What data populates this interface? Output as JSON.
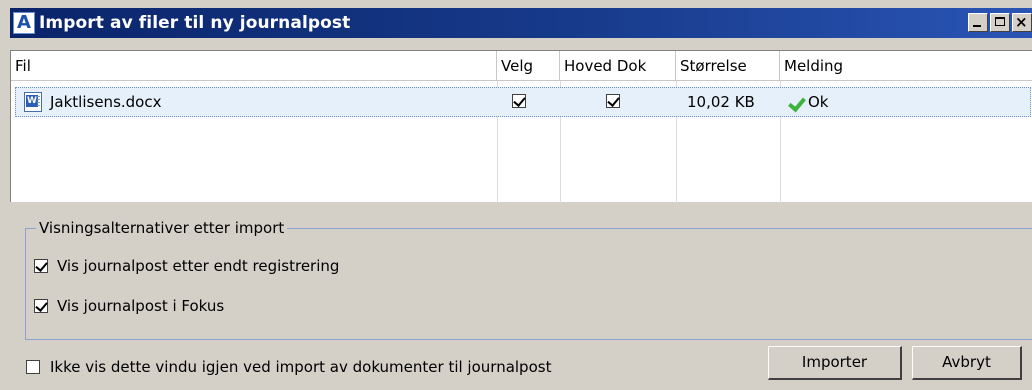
{
  "window": {
    "title": "Import av filer til ny journalpost",
    "app_icon_letter": "A",
    "close_glyph": "×"
  },
  "grid": {
    "columns": [
      "Fil",
      "Velg",
      "Hoved Dok",
      "Størrelse",
      "Melding"
    ],
    "rows": [
      {
        "file": "Jaktlisens.docx",
        "icon": "word-document-icon",
        "velg": true,
        "hoved_dok": true,
        "size": "10,02 KB",
        "status_icon": "green-check-icon",
        "message": "Ok"
      }
    ]
  },
  "options_group": {
    "legend": "Visningsalternativer etter import",
    "items": [
      {
        "label": "Vis journalpost etter endt registrering",
        "checked": true
      },
      {
        "label": "Vis journalpost i Fokus",
        "checked": true
      }
    ]
  },
  "footer": {
    "dont_show_label": "Ikke vis dette vindu igjen ved import av dokumenter til journalpost",
    "dont_show_checked": false,
    "import_button": "Importer",
    "cancel_button": "Avbryt"
  },
  "colors": {
    "titlebar_start": "#0a246a",
    "titlebar_end": "#2a55b5",
    "selection": "#e6f0fa",
    "ok_green": "#3db33d",
    "face": "#d4d0c8"
  }
}
